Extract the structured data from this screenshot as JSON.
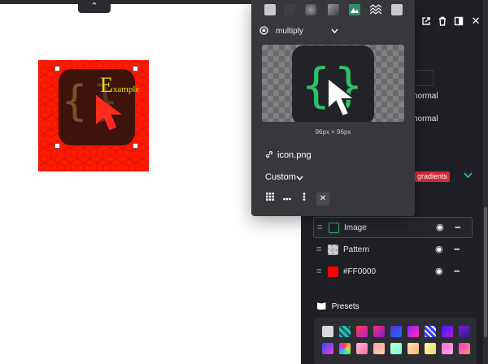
{
  "toolbar": {
    "collapse_glyph": "⌃"
  },
  "canvas": {
    "background_color": "#FF0000",
    "example_text_big": "E",
    "example_text_small": "xample"
  },
  "panel": {
    "header_icons": [
      "external-link-icon",
      "trash-icon",
      "panel-icon",
      "close-icon"
    ],
    "close_glyph": "✕",
    "blend_rows": [
      "normal",
      "normal"
    ],
    "gradients_badge": "gradients",
    "layers": [
      {
        "name": "Image",
        "swatch": "image",
        "eye": "◉",
        "remove": "−"
      },
      {
        "name": "Pattern",
        "swatch": "pattern",
        "eye": "◉",
        "remove": "−"
      },
      {
        "name": "#FF0000",
        "swatch": "#FF0000",
        "eye": "◉",
        "remove": "−"
      }
    ],
    "presets_title": "Presets",
    "presets_icon": "book-icon"
  },
  "popover": {
    "blend_mode": "multiply",
    "preview_dims": "96px × 96px",
    "filename": "icon.png",
    "size_mode": "Custom",
    "close_glyph": "✕"
  },
  "colors": {
    "panel_bg": "#1f2026",
    "popover_bg": "#37383c",
    "accent_green": "#2fbf6a",
    "accent_teal": "#2ec4b6",
    "badge_red": "#d42a34",
    "pattern_red": "#ff1a00"
  }
}
